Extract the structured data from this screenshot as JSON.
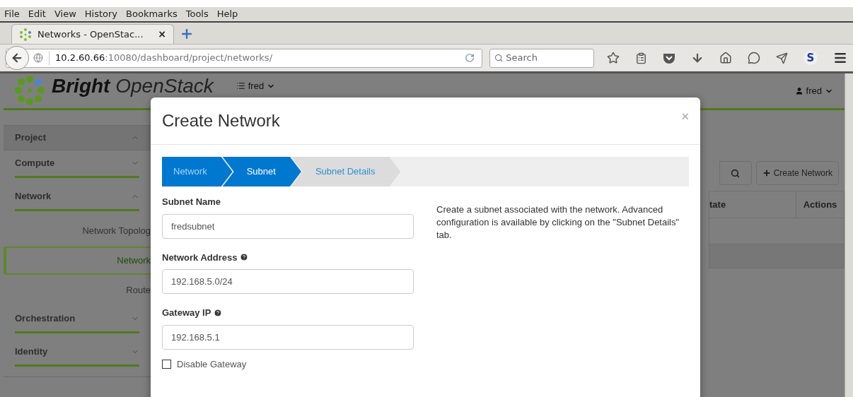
{
  "menu_bar": [
    "File",
    "Edit",
    "View",
    "History",
    "Bookmarks",
    "Tools",
    "Help"
  ],
  "browser_tab": {
    "title": "Networks - OpenStac...",
    "close": "×"
  },
  "address_bar": {
    "host": "10.2.60.66",
    "path": ":10080/dashboard/project/networks/"
  },
  "search_box": {
    "placeholder": "Search"
  },
  "extension_badge": "S",
  "header": {
    "brand": "Bright",
    "product": "OpenStack",
    "project_menu": "fred",
    "user_menu": "fred"
  },
  "sidebar": [
    {
      "kind": "section",
      "label": "Project",
      "expanded": true
    },
    {
      "kind": "section",
      "label": "Compute",
      "expanded": false
    },
    {
      "kind": "section",
      "label": "Network",
      "expanded": true,
      "children": [
        {
          "kind": "link",
          "label": "Network Topolog",
          "selected": false
        },
        {
          "kind": "link",
          "label": "Network",
          "selected": true
        },
        {
          "kind": "link",
          "label": "Route",
          "selected": false
        }
      ]
    },
    {
      "kind": "section",
      "label": "Orchestration",
      "expanded": false
    },
    {
      "kind": "section",
      "label": "Identity",
      "expanded": false
    }
  ],
  "toolbar": {
    "create_button": "Create Network"
  },
  "table": {
    "columns": [
      "tate",
      "Actions"
    ]
  },
  "modal": {
    "title": "Create Network",
    "close": "×",
    "steps": [
      {
        "label": "Network",
        "selected": false
      },
      {
        "label": "Subnet",
        "selected": true
      },
      {
        "label": "Subnet Details",
        "selected": false
      }
    ],
    "fields": [
      {
        "label": "Subnet Name",
        "help": false,
        "value": "fredsubnet"
      },
      {
        "label": "Network Address",
        "help": true,
        "value": "192.168.5.0/24"
      },
      {
        "label": "Gateway IP",
        "help": true,
        "value": "192.168.5.1"
      }
    ],
    "checkbox": {
      "label": "Disable Gateway",
      "checked": false
    },
    "description": "Create a subnet associated with the network. Advanced configuration is available by clicking on the \"Subnet Details\" tab."
  }
}
